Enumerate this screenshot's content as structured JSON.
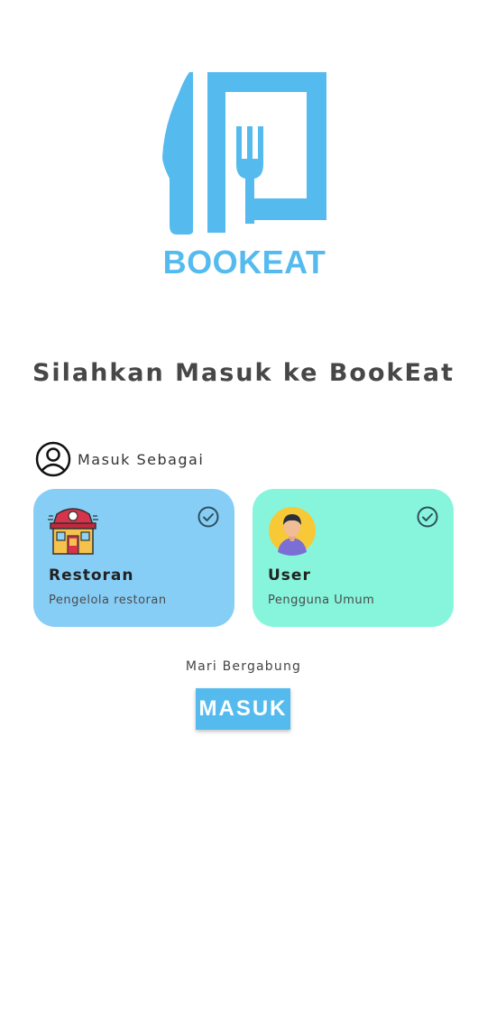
{
  "brand": {
    "name": "BOOKEAT",
    "color": "#55bbef"
  },
  "title": "Silahkan Masuk ke BookEat",
  "role_prompt": {
    "label": "Masuk Sebagai",
    "icon": "user-circle-icon"
  },
  "roles": [
    {
      "name": "Restoran",
      "description": "Pengelola restoran",
      "icon": "restaurant-building-icon",
      "selected_icon": "check-circle-icon",
      "color": "#87cef7"
    },
    {
      "name": "User",
      "description": "Pengguna Umum",
      "icon": "person-avatar-icon",
      "selected_icon": "check-circle-icon",
      "color": "#86f5dc"
    }
  ],
  "join_text": "Mari Bergabung",
  "login_button": "MASUK"
}
